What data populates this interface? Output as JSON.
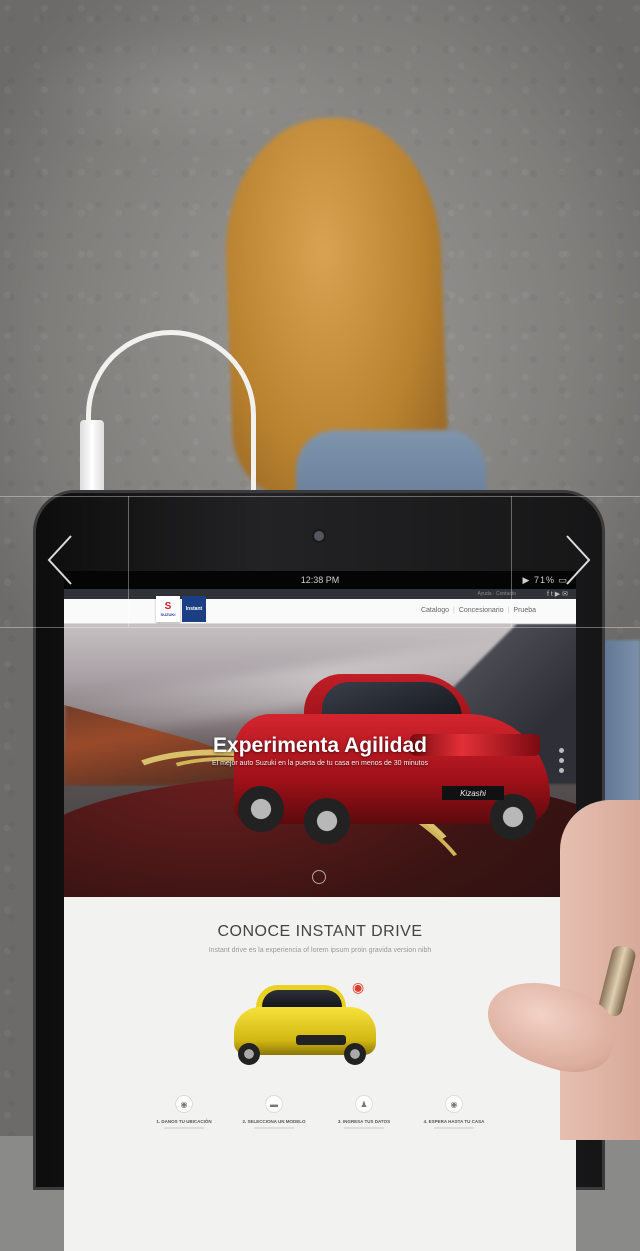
{
  "device": {
    "status_time": "12:38 PM",
    "status_battery": "▶ 71% ▭"
  },
  "site": {
    "top_help": "Ayuda · Contacto",
    "social_icons": [
      "facebook-icon",
      "twitter-icon",
      "youtube-icon",
      "email-icon"
    ],
    "social_glyphs": "f t ▶ ✉",
    "logo_primary": "SUZUKI",
    "logo_secondary": "Instant",
    "nav": [
      "Catalogo",
      "Concesionario",
      "Prueba"
    ]
  },
  "hero": {
    "title": "Experimenta Agilidad",
    "subtitle": "El mejor auto Suzuki en la puerta de tu casa en menos de 30 minutos",
    "plate": "Kizashi",
    "dots": 3
  },
  "section": {
    "title": "CONOCE INSTANT DRIVE",
    "subtitle": "Instant drive es la experiencia of lorem ipsum proin gravida version nibh",
    "steps": [
      {
        "icon": "location-pin-icon",
        "glyph": "◉",
        "label": "1. Danos tu ubicación"
      },
      {
        "icon": "car-icon",
        "glyph": "▬",
        "label": "2. Selecciona un modelo"
      },
      {
        "icon": "user-icon",
        "glyph": "♟",
        "label": "3. Ingresa tus datos"
      },
      {
        "icon": "location-pin-icon",
        "glyph": "◉",
        "label": "4. Espera hasta tu casa"
      }
    ]
  },
  "gallery": {
    "prev_icon": "chevron-left-icon",
    "next_icon": "chevron-right-icon"
  },
  "colors": {
    "brand_red": "#d41a1f",
    "brand_blue": "#1b3f82",
    "pin_red": "#e03a2a"
  }
}
